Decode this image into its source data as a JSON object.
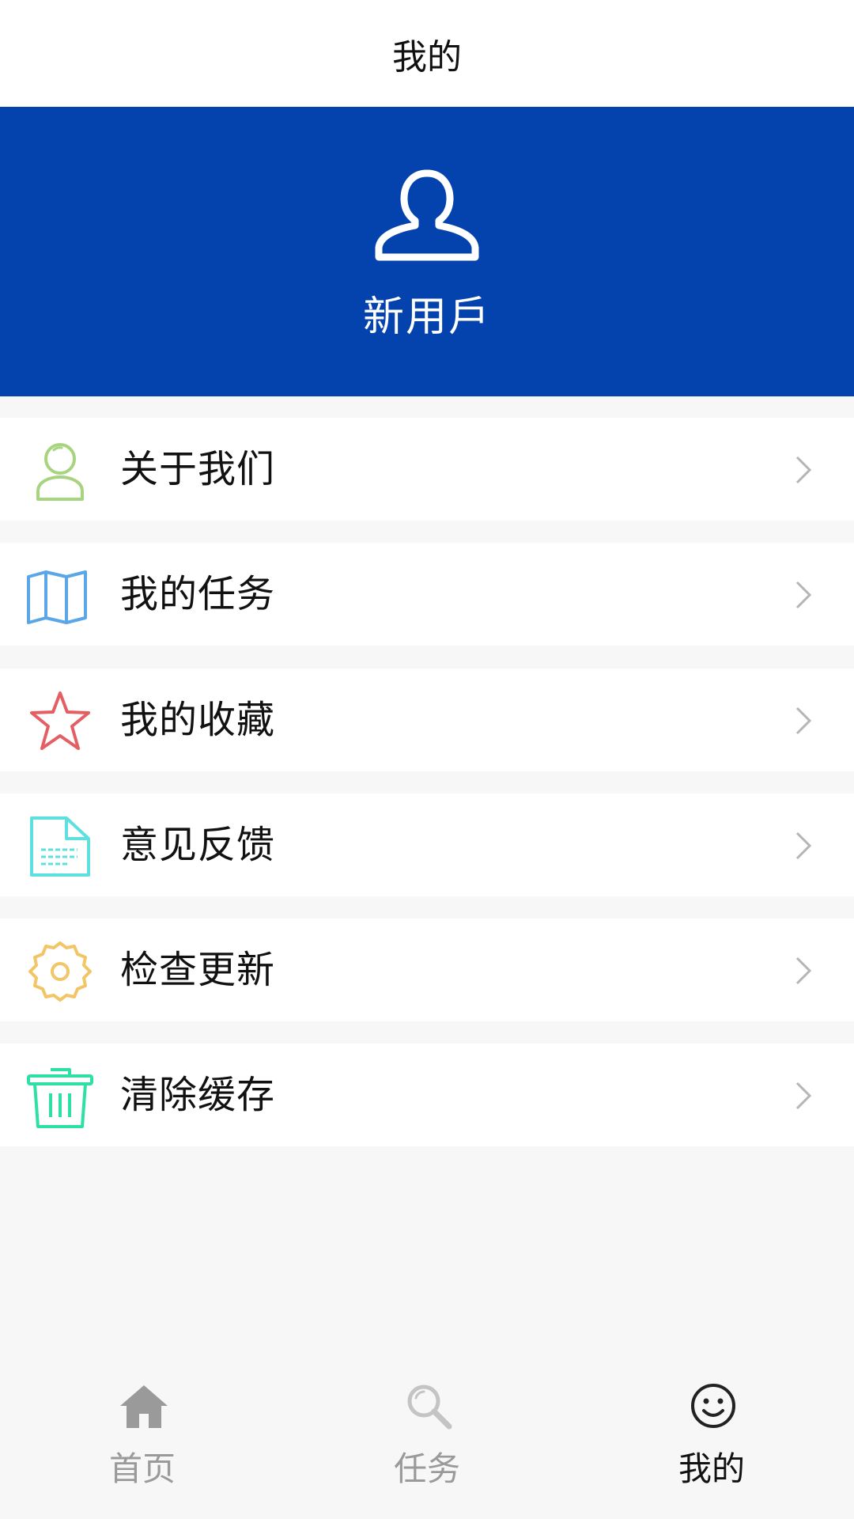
{
  "header": {
    "title": "我的"
  },
  "profile": {
    "username": "新用戶",
    "avatar_icon": "user-outline-icon"
  },
  "menu": {
    "items": [
      {
        "label": "关于我们",
        "icon": "person-icon",
        "color": "#a7d47e"
      },
      {
        "label": "我的任务",
        "icon": "map-icon",
        "color": "#5aa6e8"
      },
      {
        "label": "我的收藏",
        "icon": "star-icon",
        "color": "#e35f64"
      },
      {
        "label": "意见反馈",
        "icon": "document-icon",
        "color": "#5ee0e0"
      },
      {
        "label": "检查更新",
        "icon": "gear-icon",
        "color": "#f2c566"
      },
      {
        "label": "清除缓存",
        "icon": "trash-icon",
        "color": "#2fe0a6"
      }
    ]
  },
  "tabbar": {
    "tabs": [
      {
        "label": "首页",
        "icon": "home-icon",
        "active": false
      },
      {
        "label": "任务",
        "icon": "search-icon",
        "active": false
      },
      {
        "label": "我的",
        "icon": "smiley-icon",
        "active": true
      }
    ]
  },
  "colors": {
    "brand_blue": "#0443ad",
    "inactive_gray": "#9a9a9a"
  }
}
